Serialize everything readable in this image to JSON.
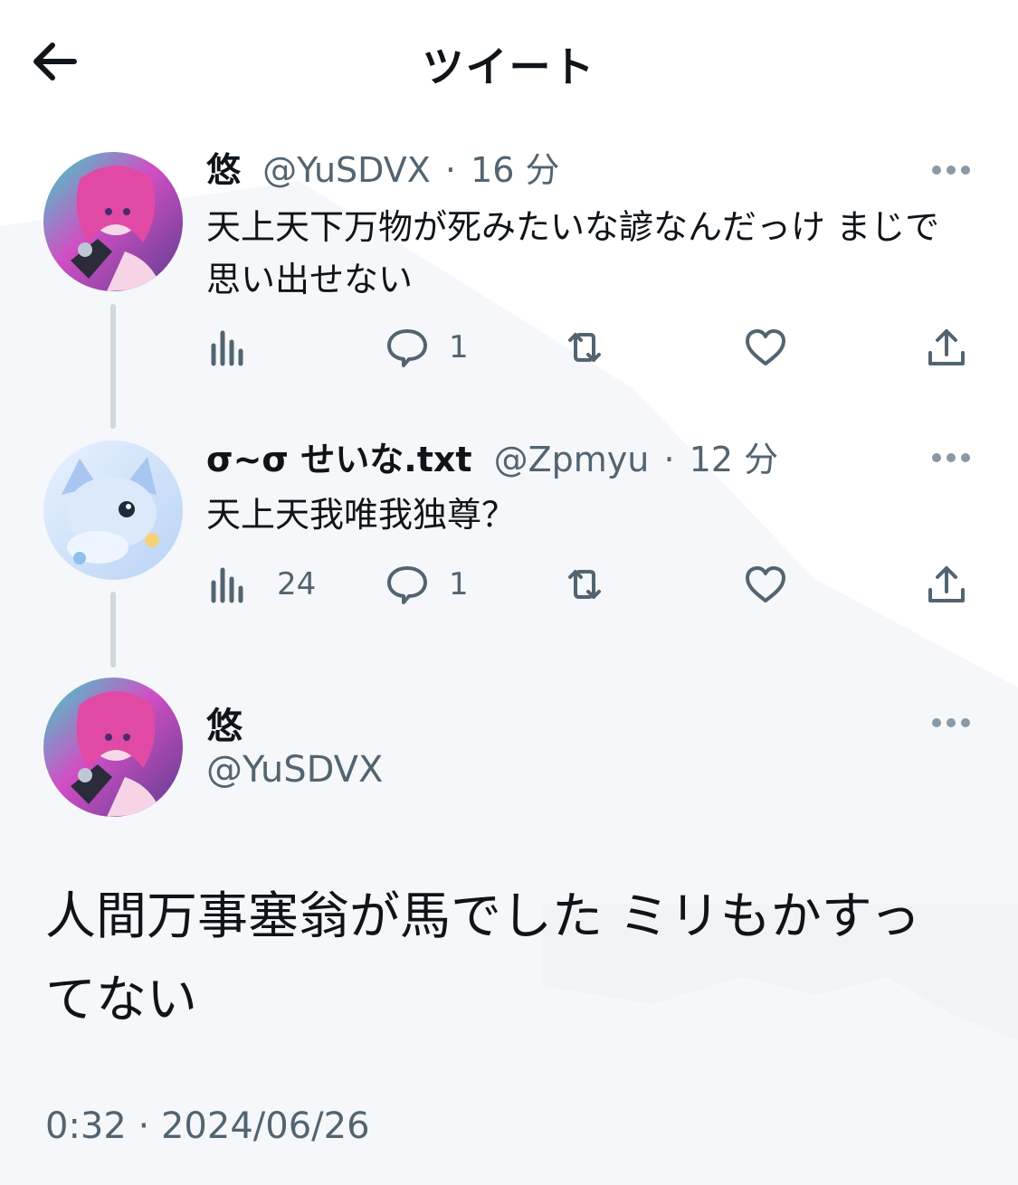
{
  "header": {
    "title": "ツイート",
    "back_icon": "arrow-left-icon"
  },
  "thread": [
    {
      "name": "悠",
      "handle": "@YuSDVX",
      "separator": "·",
      "time": "16 分",
      "text": "天上天下万物が死みたいな諺なんだっけ まじで思い出せない",
      "views": "",
      "replies": "1",
      "retweets": "",
      "likes": ""
    },
    {
      "name": "σ~σ せいな.txt",
      "handle": "@Zpmyu",
      "separator": "·",
      "time": "12 分",
      "text": "天上天我唯我独尊？",
      "views": "24",
      "replies": "1",
      "retweets": "",
      "likes": ""
    }
  ],
  "main_tweet": {
    "name": "悠",
    "handle": "@YuSDVX",
    "text": "人間万事塞翁が馬でした ミリもかすってない",
    "timestamp": "0:32 · 2024/06/26"
  },
  "colors": {
    "text": "#0f1419",
    "secondary": "#536471",
    "thread_line": "#cfd9de",
    "background": "#ffffff"
  },
  "icons": [
    "arrow-left-icon",
    "more-icon",
    "views-icon",
    "reply-icon",
    "retweet-icon",
    "like-icon",
    "share-icon"
  ]
}
